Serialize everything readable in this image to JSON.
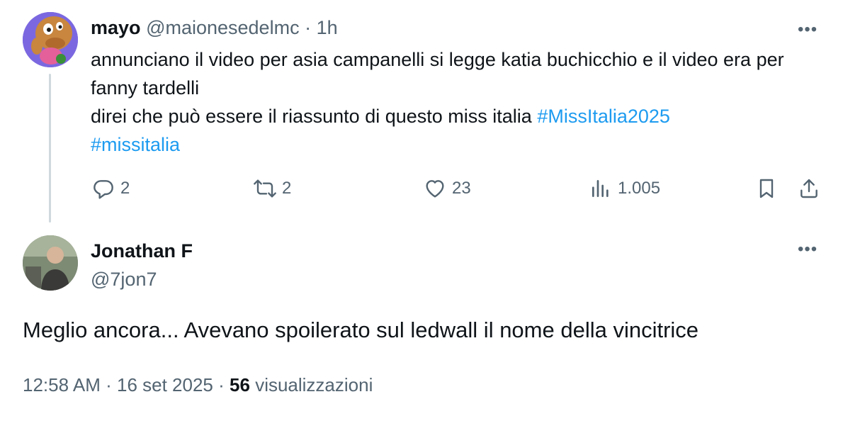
{
  "parent_tweet": {
    "display_name": "mayo",
    "handle": "@maionesedelmc",
    "separator": "·",
    "time": "1h",
    "more_icon": "more-horizontal-icon",
    "text_line1": "annunciano il video per asia campanelli si legge katia buchicchio e il video era per fanny tardelli",
    "text_line2": "direi che può essere il riassunto di questo miss italia ",
    "hashtag1": "#MissItalia2025",
    "hashtag2": "#missitalia",
    "hashtag_color": "#1d9bf0",
    "actions": {
      "replies": "2",
      "reposts": "2",
      "likes": "23",
      "views": "1.005"
    }
  },
  "reply_tweet": {
    "display_name": "Jonathan F",
    "handle": "@7jon7",
    "text": "Meglio ancora... Avevano spoilerato sul ledwall il nome della vincitrice",
    "time": "12:58 AM",
    "sep1": "·",
    "date": "16 set 2025",
    "sep2": "·",
    "views_count": "56",
    "views_label": "visualizzazioni"
  }
}
